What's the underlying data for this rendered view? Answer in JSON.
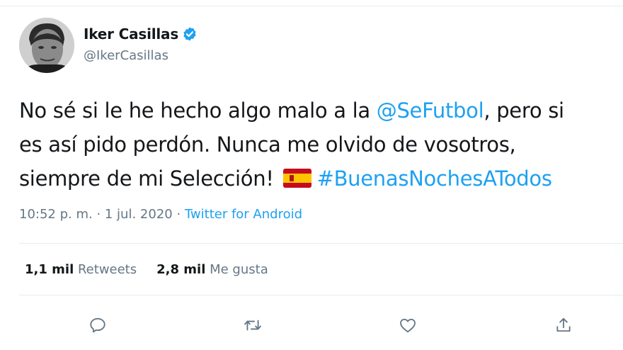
{
  "author": {
    "display_name": "Iker Casillas",
    "handle": "@IkerCasillas",
    "verified": true
  },
  "tweet": {
    "line1": {
      "text_before": "No sé si le he hecho algo malo a la ",
      "mention": "@SeFutbol",
      "text_after": ", pero si"
    },
    "line2": {
      "text": "es así pido perdón. Nunca me olvido de vosotros,"
    },
    "line3": {
      "text_before": "siempre de mi Selección! ",
      "emoji": "spain-flag",
      "hashtag": "#BuenasNochesATodos"
    }
  },
  "meta": {
    "timestamp": "10:52 p. m. · 1 jul. 2020",
    "separator": " · ",
    "source": "Twitter for Android"
  },
  "stats": {
    "retweets_count": "1,1 mil",
    "retweets_label": "Retweets",
    "likes_count": "2,8 mil",
    "likes_label": "Me gusta"
  },
  "actions": [
    {
      "icon": "reply-icon"
    },
    {
      "icon": "retweet-icon"
    },
    {
      "icon": "like-icon"
    },
    {
      "icon": "share-icon"
    }
  ],
  "colors": {
    "link": "#1da1f2",
    "text": "#14171a",
    "secondary": "#657786",
    "divider": "#e6ecf0"
  }
}
